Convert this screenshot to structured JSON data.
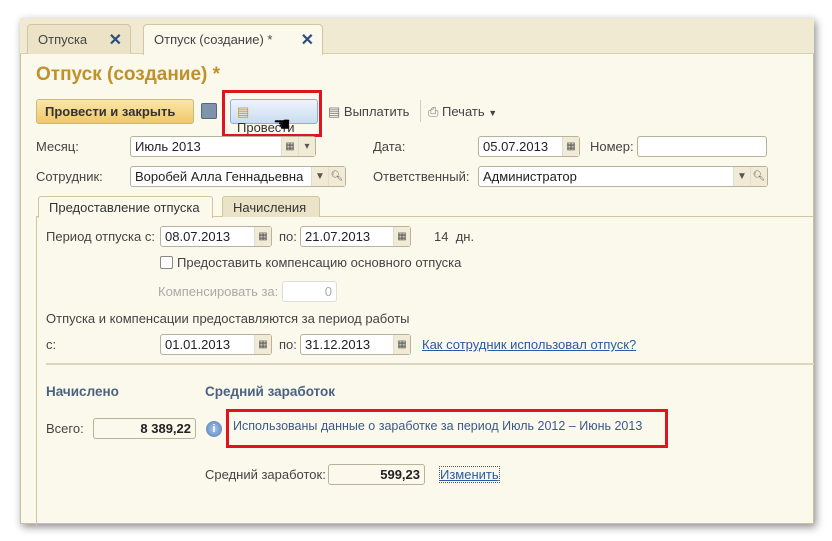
{
  "tabs": [
    {
      "label": "Отпуска"
    },
    {
      "label": "Отпуск (создание) *"
    }
  ],
  "title": "Отпуск (создание) *",
  "toolbar": {
    "post_close": "Провести и закрыть",
    "post": "Провести",
    "pay": "Выплатить",
    "print": "Печать"
  },
  "header": {
    "month_label": "Месяц:",
    "month_value": "Июль 2013",
    "date_label": "Дата:",
    "date_value": "05.07.2013",
    "number_label": "Номер:",
    "number_value": "",
    "employee_label": "Сотрудник:",
    "employee_value": "Воробей Алла Геннадьевна",
    "responsible_label": "Ответственный:",
    "responsible_value": "Администратор"
  },
  "subtabs": [
    {
      "label": "Предоставление отпуска"
    },
    {
      "label": "Начисления"
    }
  ],
  "leave": {
    "period_label": "Период отпуска с:",
    "from": "08.07.2013",
    "to_label": "по:",
    "to": "21.07.2013",
    "days": "14",
    "days_unit": "дн.",
    "compensation_label": "Предоставить компенсацию основного отпуска",
    "compensate_label": "Компенсировать за:",
    "compensate_value": "0",
    "work_period_text": "Отпуска и компенсации предоставляются за период работы",
    "work_from_label": "с:",
    "work_from": "01.01.2013",
    "work_to_label": "по:",
    "work_to": "31.12.2013",
    "usage_link": "Как сотрудник использовал отпуск?"
  },
  "accrued": {
    "heading": "Начислено",
    "total_label": "Всего:",
    "total_value": "8 389,22"
  },
  "average": {
    "heading": "Средний заработок",
    "info_text": "Использованы данные о заработке за период Июль 2012 – Июнь 2013",
    "label": "Средний заработок:",
    "value": "599,23",
    "change_link": "Изменить"
  }
}
